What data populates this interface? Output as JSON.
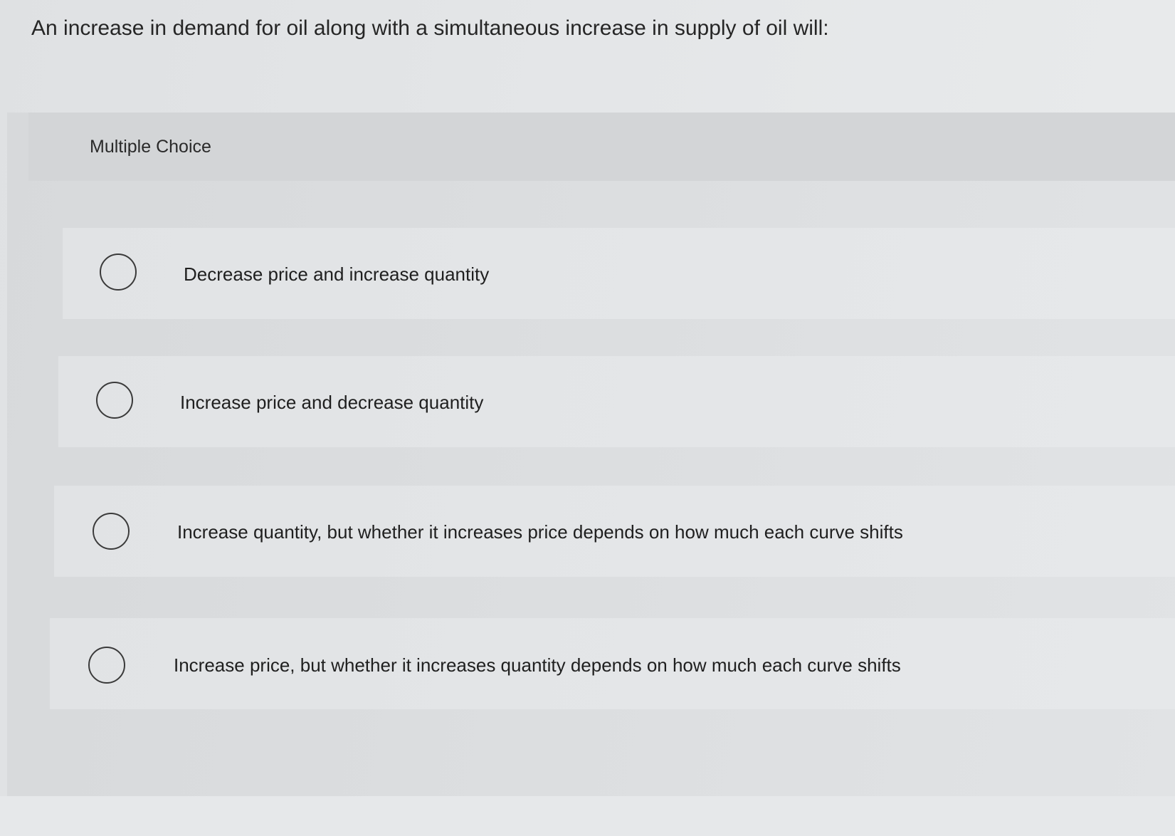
{
  "question": {
    "text": "An increase in demand for oil along with a simultaneous increase in supply of oil will:"
  },
  "panel": {
    "title": "Multiple Choice"
  },
  "choices": [
    {
      "label": "Decrease price and increase quantity",
      "selected": false
    },
    {
      "label": "Increase price and decrease quantity",
      "selected": false
    },
    {
      "label": "Increase quantity, but whether it increases price depends on how much each curve shifts",
      "selected": false
    },
    {
      "label": "Increase price, but whether it increases quantity depends on how much each curve shifts",
      "selected": false
    }
  ],
  "icons": {
    "radio": "radio-button-unchecked-icon"
  }
}
